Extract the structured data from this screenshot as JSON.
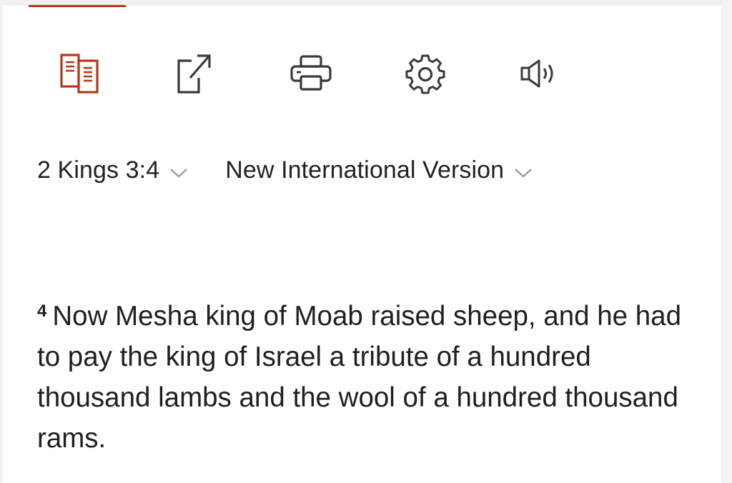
{
  "toolbar": {
    "items": [
      {
        "icon": "parallel-view-icon",
        "active": true
      },
      {
        "icon": "share-icon",
        "active": false
      },
      {
        "icon": "print-icon",
        "active": false
      },
      {
        "icon": "settings-icon",
        "active": false
      },
      {
        "icon": "audio-icon",
        "active": false
      }
    ]
  },
  "selectors": {
    "reference": "2 Kings 3:4",
    "version": "New International Version"
  },
  "passage": {
    "verse_number": "4",
    "verse_text": "Now Mesha king of Moab raised sheep, and he had to pay the king of Israel a tribute of a hundred thousand lambs and the wool of a hundred thousand rams."
  },
  "colors": {
    "accent": "#b23a1e",
    "icon": "#3a3a3a",
    "text": "#1f1f1f",
    "chevron": "#9a9a9a"
  }
}
